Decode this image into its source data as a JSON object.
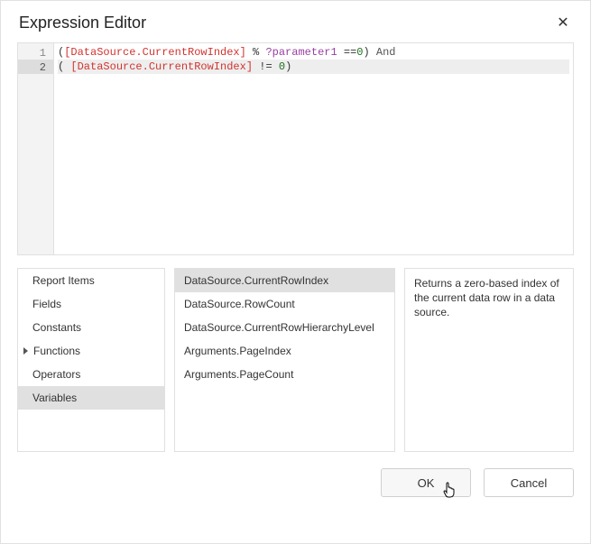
{
  "header": {
    "title": "Expression Editor",
    "close_glyph": "✕"
  },
  "editor": {
    "lines": [
      {
        "num": "1",
        "active": false,
        "segments": [
          {
            "t": "(",
            "c": ""
          },
          {
            "t": "[DataSource.CurrentRowIndex]",
            "c": "tok-bracket"
          },
          {
            "t": " % ",
            "c": ""
          },
          {
            "t": "?parameter1",
            "c": "tok-ques"
          },
          {
            "t": " ==",
            "c": ""
          },
          {
            "t": "0",
            "c": "tok-num"
          },
          {
            "t": ") ",
            "c": ""
          },
          {
            "t": "And",
            "c": "tok-kw"
          }
        ]
      },
      {
        "num": "2",
        "active": true,
        "segments": [
          {
            "t": "( ",
            "c": ""
          },
          {
            "t": "[DataSource.CurrentRowIndex]",
            "c": "tok-bracket"
          },
          {
            "t": " != ",
            "c": ""
          },
          {
            "t": "0",
            "c": "tok-num"
          },
          {
            "t": ")",
            "c": ""
          }
        ]
      }
    ]
  },
  "categories": [
    {
      "label": "Report Items",
      "expandable": false,
      "selected": false
    },
    {
      "label": "Fields",
      "expandable": false,
      "selected": false
    },
    {
      "label": "Constants",
      "expandable": false,
      "selected": false
    },
    {
      "label": "Functions",
      "expandable": true,
      "selected": false
    },
    {
      "label": "Operators",
      "expandable": false,
      "selected": false
    },
    {
      "label": "Variables",
      "expandable": false,
      "selected": true
    }
  ],
  "items": [
    {
      "label": "DataSource.CurrentRowIndex",
      "selected": true
    },
    {
      "label": "DataSource.RowCount",
      "selected": false
    },
    {
      "label": "DataSource.CurrentRowHierarchyLevel",
      "selected": false
    },
    {
      "label": "Arguments.PageIndex",
      "selected": false
    },
    {
      "label": "Arguments.PageCount",
      "selected": false
    }
  ],
  "description": "Returns a zero-based index of the current data row in a data source.",
  "footer": {
    "ok_label": "OK",
    "cancel_label": "Cancel"
  }
}
